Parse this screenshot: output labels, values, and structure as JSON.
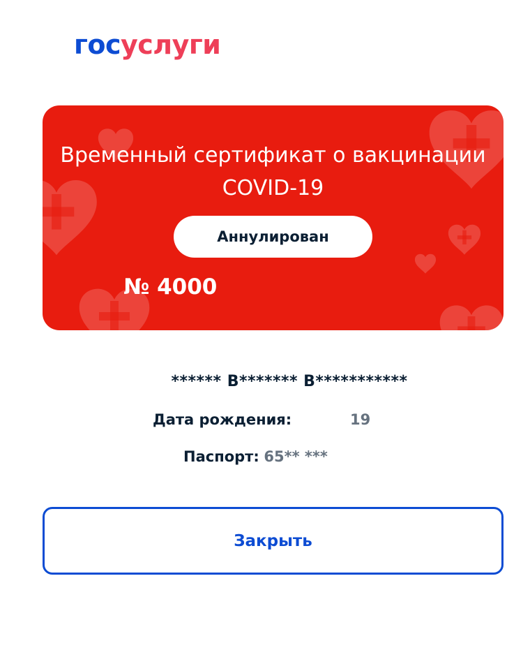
{
  "logo": {
    "part1": "гос",
    "part2": "услуги",
    "color_part1": "#0d4cd3",
    "color_part2": "#ee3f58"
  },
  "certificate": {
    "title": "Временный сертификат о вакцинации COVID-19",
    "status": "Аннулирован",
    "number": "№ 4000",
    "background_color": "#e81c0f",
    "decor_icon": "heart-cross-icon"
  },
  "holder": {
    "name": "****** В******* В***********",
    "birth_label": "Дата рождения:",
    "birth_value": "19",
    "passport_label": "Паспорт:",
    "passport_value": "65** ***"
  },
  "actions": {
    "close_label": "Закрыть",
    "accent_color": "#0d4cd3"
  }
}
